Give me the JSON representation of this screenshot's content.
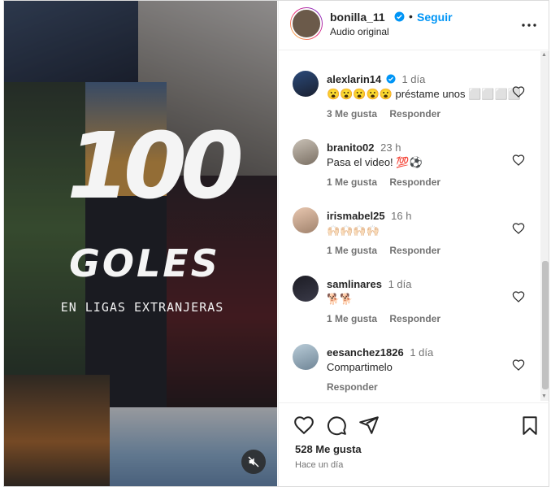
{
  "post": {
    "media": {
      "headline_number": "100",
      "headline_word": "GOLES",
      "subtitle": "EN LIGAS EXTRANJERAS",
      "mute_icon": "speaker-muted-icon"
    },
    "header": {
      "username": "bonilla_11",
      "verified": true,
      "separator": "•",
      "follow_label": "Seguir",
      "audio_label": "Audio original",
      "more_icon": "more-options-icon"
    },
    "comments": [
      {
        "username": "alexlarin14",
        "verified": true,
        "time": "1 día",
        "text": "😮😮😮😮😮 préstame unos ⬜⬜⬜⬜",
        "likes": "3 Me gusta",
        "reply": "Responder"
      },
      {
        "username": "branito02",
        "verified": false,
        "time": "23 h",
        "text": "Pasa el video! 💯⚽",
        "likes": "1 Me gusta",
        "reply": "Responder"
      },
      {
        "username": "irismabel25",
        "verified": false,
        "time": "16 h",
        "text": "🙌🏻🙌🏻🙌🏻🙌🏻",
        "likes": "1 Me gusta",
        "reply": "Responder"
      },
      {
        "username": "samlinares",
        "verified": false,
        "time": "1 día",
        "text": "🐕🐕",
        "likes": "1 Me gusta",
        "reply": "Responder"
      },
      {
        "username": "eesanchez1826",
        "verified": false,
        "time": "1 día",
        "text": "Compartimelo",
        "likes": "",
        "reply": "Responder"
      }
    ],
    "footer": {
      "likes_count": "528 Me gusta",
      "posted_ago": "Hace un día"
    },
    "colors": {
      "accent": "#0095f6",
      "text": "#262626",
      "muted": "#737373",
      "border": "#dbdbdb"
    }
  }
}
